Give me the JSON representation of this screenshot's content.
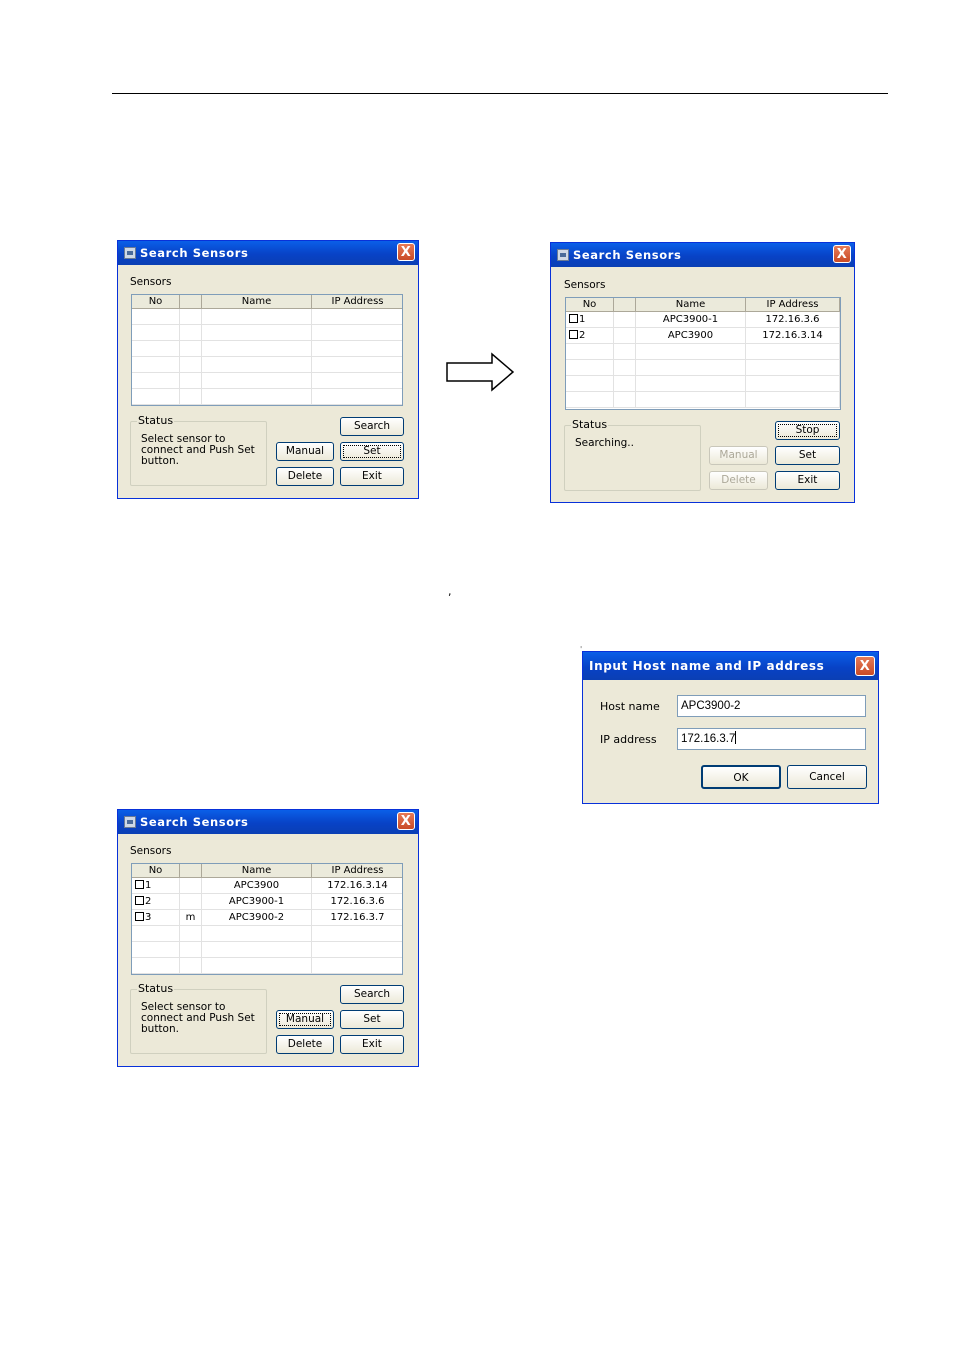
{
  "page": {
    "comma": ",",
    "tick": "'"
  },
  "dialog1": {
    "title": "Search Sensors",
    "close": "X",
    "sensors_label": "Sensors",
    "columns": [
      "No",
      "",
      "Name",
      "IP Address"
    ],
    "rows": [],
    "status_label": "Status",
    "status_text": [
      "Select sensor to",
      "connect and Push Set",
      "button."
    ],
    "buttons": {
      "search": "Search",
      "manual": "Manual",
      "set": "Set",
      "delete": "Delete",
      "exit": "Exit"
    }
  },
  "dialog2": {
    "title": "Search Sensors",
    "close": "X",
    "sensors_label": "Sensors",
    "columns": [
      "No",
      "",
      "Name",
      "IP Address"
    ],
    "rows": [
      {
        "no": "1",
        "flag": "",
        "name": "APC3900-1",
        "ip": "172.16.3.6"
      },
      {
        "no": "2",
        "flag": "",
        "name": "APC3900",
        "ip": "172.16.3.14"
      }
    ],
    "status_label": "Status",
    "status_text": [
      "Searching.."
    ],
    "buttons": {
      "stop": "Stop",
      "manual": "Manual",
      "set": "Set",
      "delete": "Delete",
      "exit": "Exit"
    }
  },
  "dialog3": {
    "title": "Input Host name and IP address",
    "close": "X",
    "host_label": "Host name",
    "host_value": "APC3900-2",
    "ip_label": "IP address",
    "ip_value": "172.16.3.7",
    "ok": "OK",
    "cancel": "Cancel"
  },
  "dialog4": {
    "title": "Search Sensors",
    "close": "X",
    "sensors_label": "Sensors",
    "columns": [
      "No",
      "",
      "Name",
      "IP Address"
    ],
    "rows": [
      {
        "no": "1",
        "flag": "",
        "name": "APC3900",
        "ip": "172.16.3.14"
      },
      {
        "no": "2",
        "flag": "",
        "name": "APC3900-1",
        "ip": "172.16.3.6"
      },
      {
        "no": "3",
        "flag": "m",
        "name": "APC3900-2",
        "ip": "172.16.3.7"
      }
    ],
    "status_label": "Status",
    "status_text": [
      "Select sensor to",
      "connect and Push Set",
      "button."
    ],
    "buttons": {
      "search": "Search",
      "manual": "Manual",
      "set": "Set",
      "delete": "Delete",
      "exit": "Exit"
    }
  },
  "icons": {
    "app": "sensor-app-icon",
    "close": "close-icon",
    "arrow": "right-arrow-icon"
  }
}
